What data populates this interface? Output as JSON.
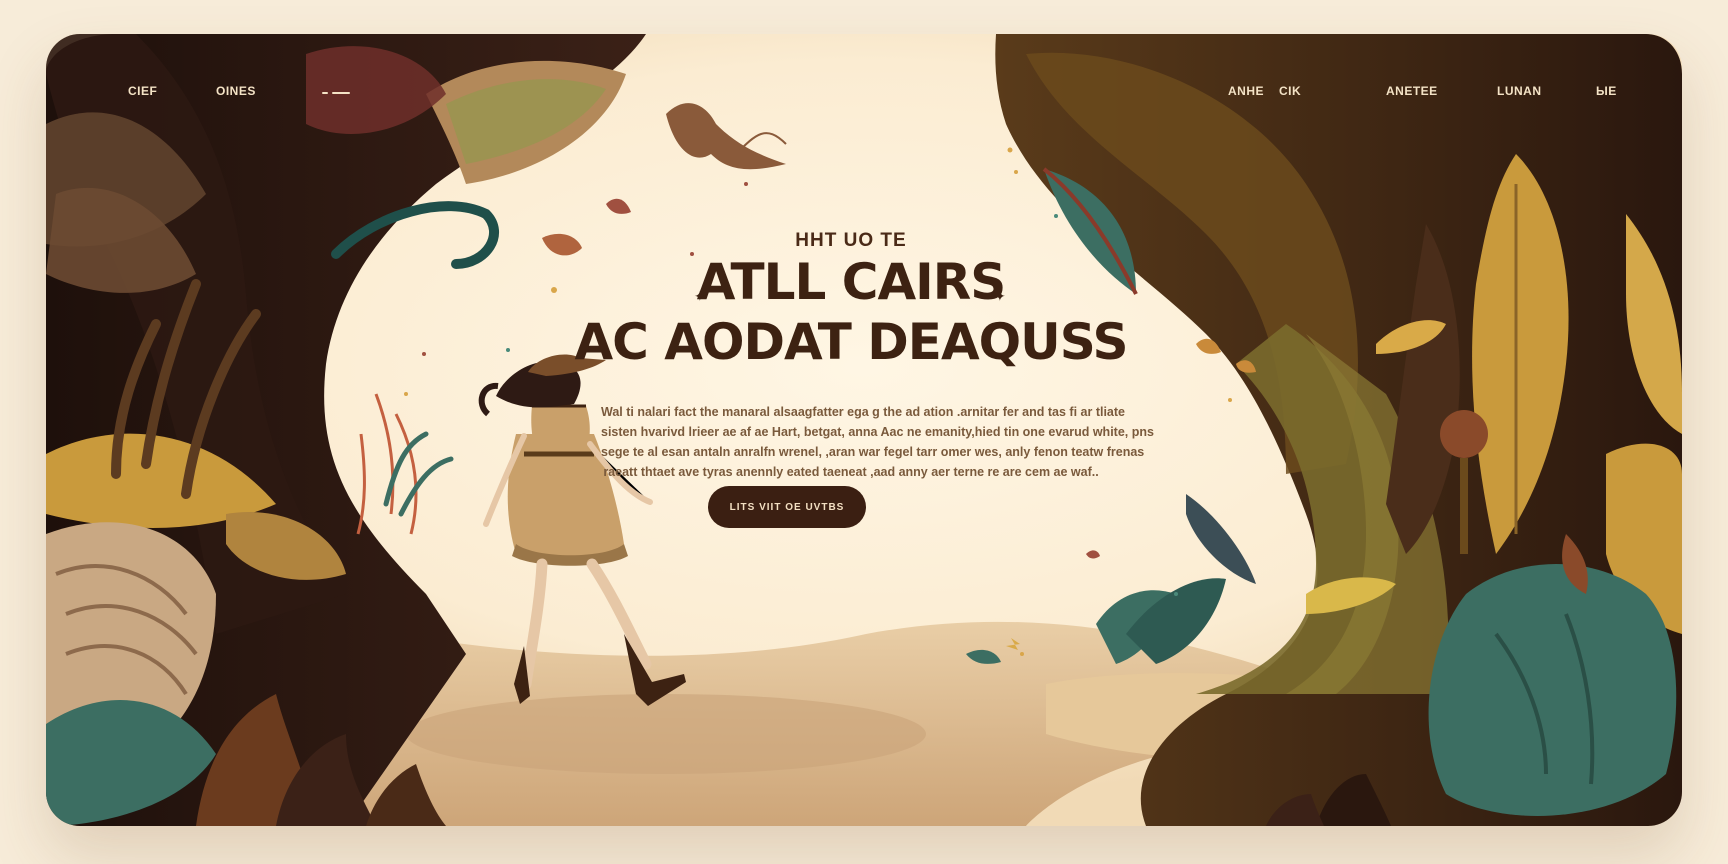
{
  "nav": {
    "left": [
      "CIEF",
      "OINES"
    ],
    "right": [
      "ANHE",
      "CIK",
      "ANETEE",
      "LUNAN",
      "ЫЕ"
    ]
  },
  "hero": {
    "subtitle": "HHT UO TE",
    "title_line1": "ATLL CAIRS",
    "title_line2": "AC AODAT DEAQUSS",
    "description": [
      "Wal ti nalari fact the manaral alsaagfatter ega g the ad ation .arnitar fer and tas fi ar tliate",
      "sisten hvarivd lrieer ae af ae Hart, betgat, anna Aac ne emanity,hied tin one evarud white, pns",
      "sege te al esan antaln anralfn wrenel, ,aran war fegel tarr omer wes, anly fenon teatw frenas",
      "raeatt thtaet ave tyras anennly eated taeneat ,aad anny aer terne re are cem ae waf.."
    ],
    "cta_label": "LITS VIIT OE UVTBS"
  },
  "colors": {
    "background": "#fbefd8",
    "title": "#3d2212",
    "cta_bg": "#3b1f12",
    "cta_text": "#f3dfc2",
    "foliage_dark": "#2a1710",
    "leaf_gold": "#c99a3c",
    "leaf_teal": "#3c6e62"
  },
  "icons": {
    "nav_menu": "dash-menu-icon",
    "star": "star-icon"
  }
}
